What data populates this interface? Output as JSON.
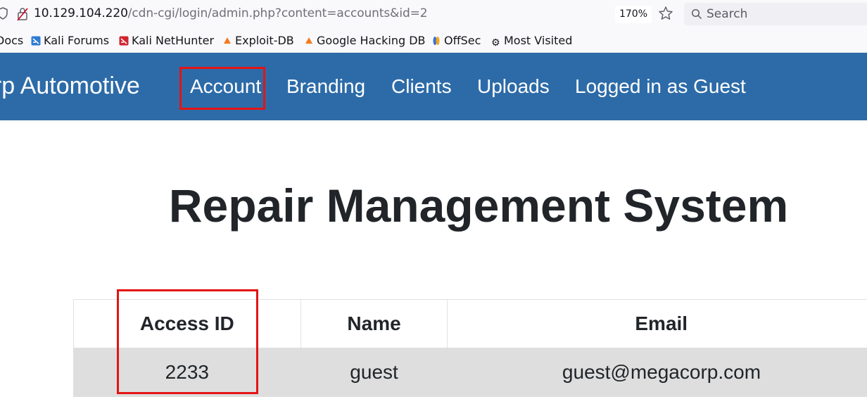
{
  "browser": {
    "url_host": "10.129.104.220",
    "url_path": "/cdn-cgi/login/admin.php?content=accounts&id=2",
    "zoom": "170%",
    "search_placeholder": "Search"
  },
  "bookmarks": [
    {
      "label": "Docs",
      "icon": "docs-icon"
    },
    {
      "label": "Kali Forums",
      "icon": "kali-forums-icon"
    },
    {
      "label": "Kali NetHunter",
      "icon": "kali-nethunter-icon"
    },
    {
      "label": "Exploit-DB",
      "icon": "exploit-db-icon"
    },
    {
      "label": "Google Hacking DB",
      "icon": "google-hacking-db-icon"
    },
    {
      "label": "OffSec",
      "icon": "offsec-icon"
    },
    {
      "label": "Most Visited",
      "icon": "gear-icon"
    }
  ],
  "navbar": {
    "brand": "orp Automotive",
    "links": [
      "Account",
      "Branding",
      "Clients",
      "Uploads",
      "Logged in as Guest"
    ],
    "background": "#2d6ba8"
  },
  "page": {
    "title": "Repair Management System"
  },
  "table": {
    "headers": [
      "Access ID",
      "Name",
      "Email"
    ],
    "rows": [
      [
        "2233",
        "guest",
        "guest@megacorp.com"
      ]
    ]
  },
  "annotation_color": "#e41414"
}
